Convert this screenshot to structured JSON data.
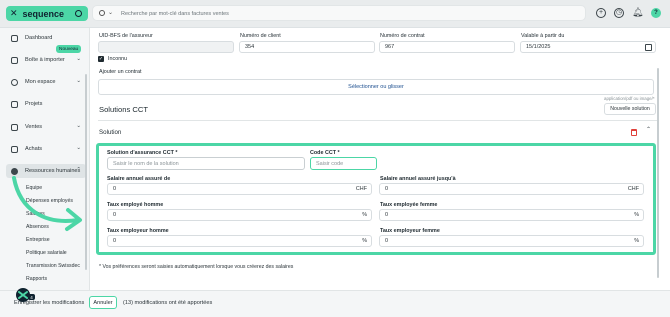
{
  "app": {
    "name": "sequence",
    "accent": "#4cd6a6",
    "danger": "#e0403a",
    "link": "#1d4f8f"
  },
  "search": {
    "placeholder": "Recherche par mot-clé dans factures ventes"
  },
  "topbar_icons": [
    "add-circle-icon",
    "clock-icon",
    "bell-icon",
    "help-icon"
  ],
  "help_glyph": "?",
  "sidebar": {
    "items": [
      {
        "label": "Dashboard",
        "icon": "home-icon"
      },
      {
        "label": "Boîte à importer",
        "icon": "inbox-icon",
        "badge": "Nouveau"
      },
      {
        "label": "Mon espace",
        "icon": "user-icon"
      },
      {
        "label": "Projets",
        "icon": "check-square-icon"
      },
      {
        "label": "Ventes",
        "icon": "lock-icon"
      },
      {
        "label": "Achats",
        "icon": "cart-icon"
      },
      {
        "label": "Ressources humaines",
        "icon": "people-icon"
      }
    ],
    "subitems": [
      "Equipe",
      "Dépenses employés",
      "Salaires",
      "Absences",
      "Entreprise",
      "Politique salariale",
      "Transmission Swissdec",
      "Rapports"
    ]
  },
  "form": {
    "uid_label": "UID-BFS de l'assureur",
    "uid_value": "",
    "client_label": "Numéro de client",
    "client_value": "354",
    "contract_label": "Numéro de contrat",
    "contract_value": "967",
    "valid_label": "Valable à partir du",
    "valid_value": "15/1/2025",
    "unknown_label": "Inconnu",
    "unknown_checked": true,
    "attach_label": "Ajouter un contrat",
    "attach_link": "Sélectionner ou glisser"
  },
  "section": {
    "title": "Solutions CCT",
    "tip": "application/pdf ou image/*",
    "new_button": "Nouvelle solution",
    "solution_label": "Solution"
  },
  "solution": {
    "name_label": "Solution d'assurance CCT *",
    "name_placeholder": "Saisir le nom de la solution",
    "code_label": "Code CCT *",
    "code_placeholder": "Saisir code",
    "salary_min_label": "Salaire annuel assuré de",
    "salary_min_value": "0",
    "salary_max_label": "Salaire annuel assuré jusqu'à",
    "salary_max_value": "0",
    "currency": "CHF",
    "rate_employee_m_label": "Taux employé homme",
    "rate_employee_m_value": "0",
    "rate_employee_f_label": "Taux employée femme",
    "rate_employee_f_value": "0",
    "rate_employer_m_label": "Taux employeur homme",
    "rate_employer_m_value": "0",
    "rate_employer_f_label": "Taux employeur femme",
    "rate_employer_f_value": "0",
    "percent": "%"
  },
  "note": "* Vos préférences seront saisies automatiquement lorsque vous créerez des salaires",
  "bottom": {
    "save_text": "Enregistrer les modifications",
    "cancel": "Annuler",
    "modifications": "(13) modifications ont été apportées",
    "fab_count": "4"
  }
}
